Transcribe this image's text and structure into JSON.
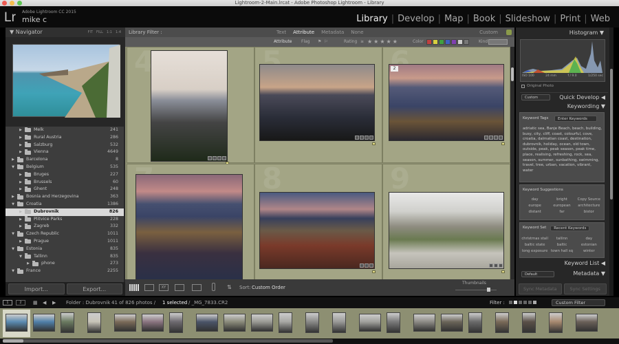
{
  "window": {
    "title": "Lightroom-2-Main.lrcat - Adobe Photoshop Lightroom - Library"
  },
  "app": {
    "logo": "Lr",
    "product": "Adobe Lightroom CC 2015",
    "user": "mike c"
  },
  "modules": [
    {
      "label": "Library",
      "active": true
    },
    {
      "label": "Develop",
      "active": false
    },
    {
      "label": "Map",
      "active": false
    },
    {
      "label": "Book",
      "active": false
    },
    {
      "label": "Slideshow",
      "active": false
    },
    {
      "label": "Print",
      "active": false
    },
    {
      "label": "Web",
      "active": false
    }
  ],
  "navigator": {
    "title": "Navigator",
    "zoom_options": [
      "FIT",
      "FILL",
      "1:1",
      "1:4"
    ]
  },
  "folders": [
    {
      "name": "Melk",
      "count": "241",
      "level": 2,
      "expanded": false,
      "selected": false
    },
    {
      "name": "Rural Austria",
      "count": "286",
      "level": 2,
      "expanded": false,
      "selected": false
    },
    {
      "name": "Salzburg",
      "count": "532",
      "level": 2,
      "expanded": false,
      "selected": false
    },
    {
      "name": "Vienna",
      "count": "4649",
      "level": 2,
      "expanded": false,
      "selected": false
    },
    {
      "name": "Barcelona",
      "count": "8",
      "level": 1,
      "expanded": false,
      "selected": false
    },
    {
      "name": "Belgium",
      "count": "535",
      "level": 1,
      "expanded": true,
      "selected": false
    },
    {
      "name": "Bruges",
      "count": "227",
      "level": 2,
      "expanded": false,
      "selected": false
    },
    {
      "name": "Brussels",
      "count": "60",
      "level": 2,
      "expanded": false,
      "selected": false
    },
    {
      "name": "Ghent",
      "count": "248",
      "level": 2,
      "expanded": false,
      "selected": false
    },
    {
      "name": "Bosnia and Herzegovina",
      "count": "363",
      "level": 1,
      "expanded": false,
      "selected": false
    },
    {
      "name": "Croatia",
      "count": "1386",
      "level": 1,
      "expanded": true,
      "selected": false
    },
    {
      "name": "Dubrovnik",
      "count": "826",
      "level": 2,
      "expanded": false,
      "selected": true
    },
    {
      "name": "Plitvice Parks",
      "count": "228",
      "level": 2,
      "expanded": false,
      "selected": false
    },
    {
      "name": "Zagreb",
      "count": "332",
      "level": 2,
      "expanded": false,
      "selected": false
    },
    {
      "name": "Czech Republic",
      "count": "1011",
      "level": 1,
      "expanded": true,
      "selected": false
    },
    {
      "name": "Prague",
      "count": "1011",
      "level": 2,
      "expanded": false,
      "selected": false
    },
    {
      "name": "Estonia",
      "count": "835",
      "level": 1,
      "expanded": true,
      "selected": false
    },
    {
      "name": "Tallinn",
      "count": "835",
      "level": 2,
      "expanded": true,
      "selected": false
    },
    {
      "name": "phone",
      "count": "273",
      "level": 3,
      "expanded": false,
      "selected": false
    },
    {
      "name": "France",
      "count": "2255",
      "level": 1,
      "expanded": true,
      "selected": false
    }
  ],
  "left_buttons": {
    "import": "Import...",
    "export": "Export..."
  },
  "library_filter": {
    "title": "Library Filter :",
    "tabs": [
      "Text",
      "Attribute",
      "Metadata",
      "None"
    ],
    "active_tab": "Attribute",
    "preset": "Custom",
    "attr_label": "Attribute",
    "flag_label": "Flag",
    "rating_label": "Rating",
    "rating_op": "≥",
    "color_label": "Color",
    "kind_label": "Kind",
    "color_swatches": [
      "#c04040",
      "#d8d040",
      "#40a040",
      "#4060c0",
      "#8040b0",
      "#cccccc",
      "#777777"
    ]
  },
  "grid": {
    "cells": [
      {
        "index": "4",
        "stack": ""
      },
      {
        "index": "5",
        "stack": ""
      },
      {
        "index": "6",
        "stack": "2"
      },
      {
        "index": "7",
        "stack": ""
      },
      {
        "index": "8",
        "stack": ""
      },
      {
        "index": "9",
        "stack": ""
      }
    ]
  },
  "toolbar": {
    "sort_label": "Sort:",
    "sort_value": "Custom Order",
    "thumbnails_label": "Thumbnails"
  },
  "histogram": {
    "title": "Histogram",
    "iso": "ISO 100",
    "focal": "24 mm",
    "aperture": "f / 9.0",
    "shutter": "1/250 sec",
    "original_photo": "Original Photo"
  },
  "quick_develop": {
    "title": "Quick Develop",
    "preset": "Custom"
  },
  "keywording": {
    "title": "Keywording",
    "tags_label": "Keyword Tags",
    "tags_mode": "Enter Keywords",
    "keywords": "adriatic sea, Banje Beach, beach, building, busy, city, cliff, coast, colourful, cove, croatia, dalmatian coast, destination, dubrovnik, holiday, ocean, old town, outside, peak, peak season, peak time, place, realising, refreshing, rock, sea, season, summer, sunbathing, swimming, travel, tree, urban, vacation, vibrant, water",
    "suggestions_label": "Keyword Suggestions",
    "suggestions": [
      "day",
      "bright",
      "Copy Source",
      "europe",
      "european",
      "architecture",
      "distant",
      "far",
      "bistor"
    ],
    "set_label": "Keyword Set",
    "set_value": "Recent Keywords",
    "set_keywords": [
      "christmas stall",
      "tallinn",
      "day",
      "baltic state",
      "baltic",
      "estonian",
      "long exposure",
      "town hall sq",
      "winter"
    ]
  },
  "keyword_list": {
    "title": "Keyword List"
  },
  "metadata": {
    "title": "Metadata",
    "preset": "Default"
  },
  "sync_buttons": {
    "metadata": "Sync Metadata",
    "settings": "Sync Settings"
  },
  "statusbar": {
    "screen1": "1",
    "screen2": "2",
    "folder": "Folder : Dubrovnik",
    "count": "41 of 826 photos /",
    "selected": "1 selected",
    "filename": "/ _MG_7833.CR2",
    "filter_label": "Filter :",
    "filter_value": "Custom Filter"
  },
  "filmstrip": {
    "count_visible": 22
  }
}
